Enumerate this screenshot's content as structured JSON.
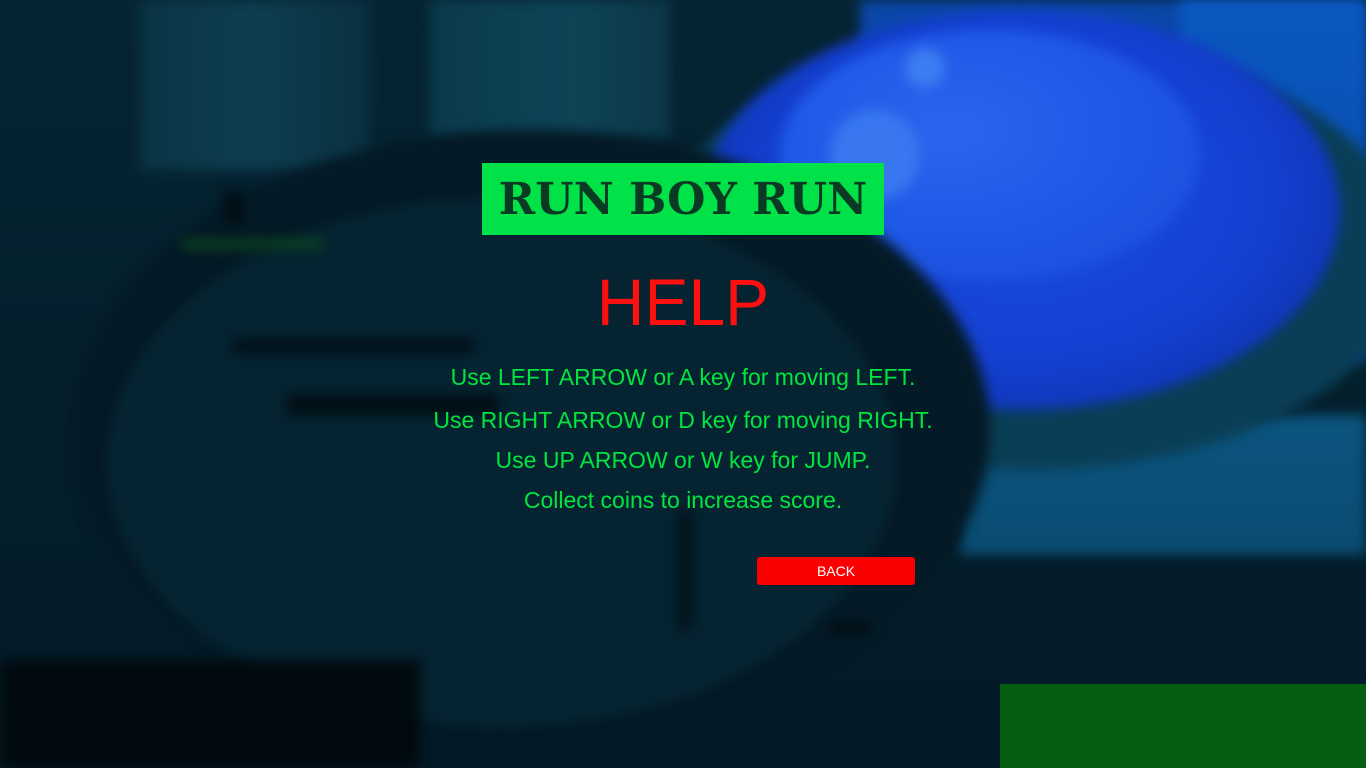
{
  "logo": {
    "text": "RUN BOY RUN",
    "background_color": "#00e247",
    "text_color": "#0a3a24"
  },
  "title": {
    "text": "HELP",
    "color": "#ff1010"
  },
  "instructions": [
    "Use LEFT ARROW or A key for moving LEFT.",
    "Use RIGHT ARROW or D key for moving RIGHT.",
    "Use UP ARROW or W key for JUMP.",
    "Collect coins to increase score."
  ],
  "instructions_color": "#00e63e",
  "back_button": {
    "label": "BACK",
    "color": "#fb0000"
  }
}
